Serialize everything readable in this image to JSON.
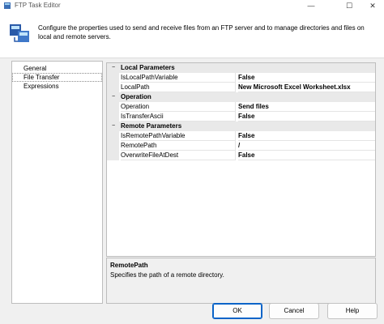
{
  "window": {
    "title": "FTP Task Editor"
  },
  "header": {
    "description": "Configure the properties used to send and receive files from an FTP server and to manage directories and files on local and remote servers."
  },
  "nav": {
    "items": [
      {
        "label": "General"
      },
      {
        "label": "File Transfer",
        "selected": true
      },
      {
        "label": "Expressions"
      }
    ]
  },
  "properties": {
    "categories": [
      {
        "title": "Local Parameters",
        "rows": [
          {
            "name": "IsLocalPathVariable",
            "value": "False"
          },
          {
            "name": "LocalPath",
            "value": "New Microsoft Excel Worksheet.xlsx"
          }
        ]
      },
      {
        "title": "Operation",
        "rows": [
          {
            "name": "Operation",
            "value": "Send files"
          },
          {
            "name": "IsTransferAscii",
            "value": "False"
          }
        ]
      },
      {
        "title": "Remote Parameters",
        "rows": [
          {
            "name": "IsRemotePathVariable",
            "value": "False"
          },
          {
            "name": "RemotePath",
            "value": "/"
          },
          {
            "name": "OverwriteFileAtDest",
            "value": "False"
          }
        ]
      }
    ],
    "collapse_glyph": "−"
  },
  "description_box": {
    "title": "RemotePath",
    "text": "Specifies the path of a remote directory."
  },
  "buttons": {
    "ok": "OK",
    "cancel": "Cancel",
    "help": "Help"
  },
  "icons": {
    "minimize": "—",
    "close": "✕",
    "restore": "☐"
  },
  "colors": {
    "accent": "#0a64c8",
    "selection_border": "#8a8a8a"
  }
}
